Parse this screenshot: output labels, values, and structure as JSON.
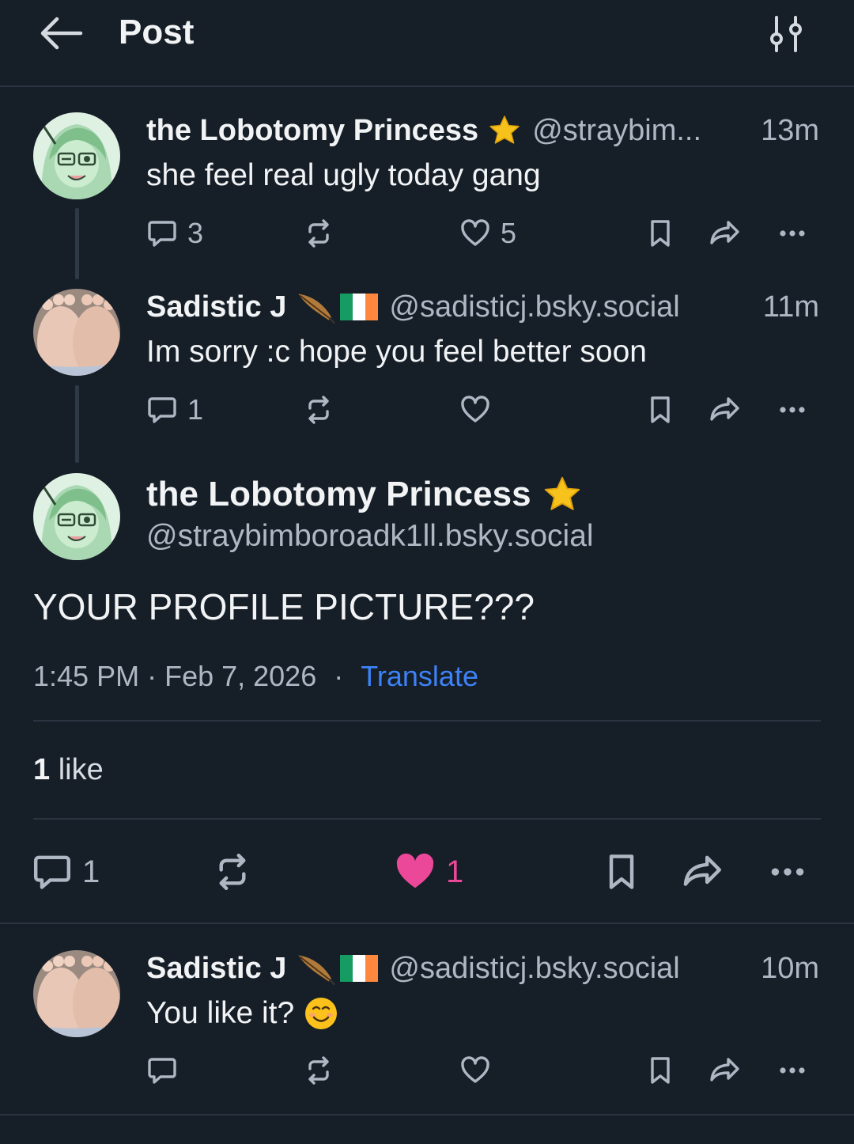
{
  "header": {
    "title": "Post",
    "back_icon": "arrow-left-icon",
    "filter_icon": "sliders-icon"
  },
  "thread": [
    {
      "name": "the Lobotomy Princess",
      "badge": "star-emoji",
      "handle": "@straybim...",
      "time": "13m",
      "text": "she feel real ugly today gang",
      "replies": "3",
      "likes": "5",
      "reposts": ""
    },
    {
      "name": "Sadistic J",
      "badge": "feather-and-irish-flag-emoji",
      "handle": "@sadisticj.bsky.social",
      "time": "11m",
      "text": "Im sorry :c hope you feel better soon",
      "replies": "1",
      "likes": "",
      "reposts": ""
    }
  ],
  "main_post": {
    "name": "the Lobotomy Princess",
    "badge": "star-emoji",
    "handle": "@straybimboroadk1ll.bsky.social",
    "text": "YOUR PROFILE PICTURE???",
    "time": "1:45 PM",
    "date": "Feb 7, 2026",
    "dot": "·",
    "translate": "Translate",
    "like_count": "1",
    "like_word": "like",
    "replies": "1",
    "likes": "1",
    "liked_color": "#ec4899"
  },
  "reply": {
    "name": "Sadistic J",
    "badge": "feather-and-irish-flag-emoji",
    "handle": "@sadisticj.bsky.social",
    "time": "10m",
    "text": "You like it?",
    "text_emoji": "smiling-face-emoji"
  },
  "colors": {
    "background": "#161e27",
    "muted": "#aeb8c4",
    "link": "#3d82f6",
    "divider": "#2a3441"
  }
}
